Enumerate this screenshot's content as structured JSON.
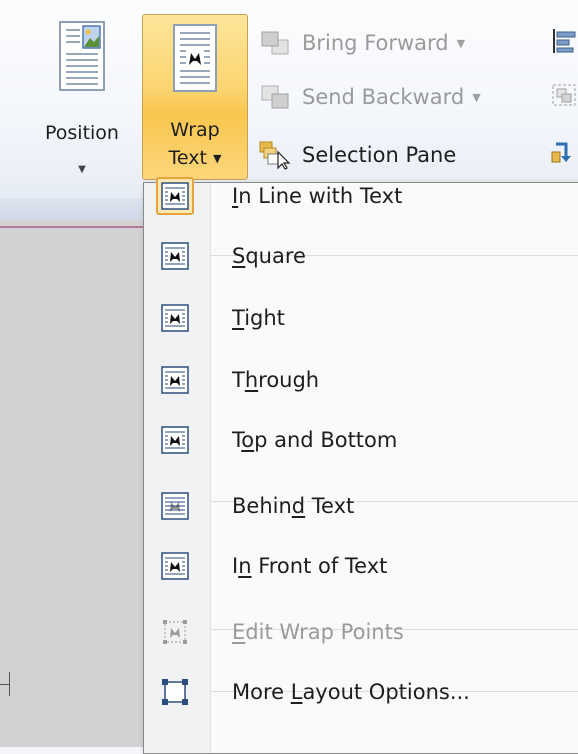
{
  "ribbon": {
    "position_label": "Position",
    "wrap_label_line1": "Wrap",
    "wrap_label_line2": "Text",
    "bring_forward": "Bring Forward",
    "send_backward": "Send Backward",
    "selection_pane": "Selection Pane"
  },
  "menu": {
    "items": [
      {
        "pre": "",
        "key": "I",
        "post": "n Line with Text",
        "icon": "wrap-inline-icon",
        "disabled": false
      },
      {
        "pre": "",
        "key": "S",
        "post": "quare",
        "icon": "wrap-square-icon",
        "disabled": false
      },
      {
        "pre": "",
        "key": "T",
        "post": "ight",
        "icon": "wrap-tight-icon",
        "disabled": false
      },
      {
        "pre": "T",
        "key": "h",
        "post": "rough",
        "icon": "wrap-through-icon",
        "disabled": false
      },
      {
        "pre": "T",
        "key": "o",
        "post": "p and Bottom",
        "icon": "wrap-top-bottom-icon",
        "disabled": false
      },
      {
        "pre": "Behin",
        "key": "d",
        "post": " Text",
        "icon": "wrap-behind-text-icon",
        "disabled": false
      },
      {
        "pre": "I",
        "key": "n",
        "post": " Front of Text",
        "icon": "wrap-in-front-icon",
        "disabled": false
      },
      {
        "pre": "",
        "key": "E",
        "post": "dit Wrap Points",
        "icon": "edit-wrap-points-icon",
        "disabled": true
      },
      {
        "pre": "More ",
        "key": "L",
        "post": "ayout Options...",
        "icon": "more-layout-icon",
        "disabled": false
      }
    ]
  },
  "colors": {
    "accent_pressed": "#fbd570",
    "selected_border": "#e8a33b"
  }
}
